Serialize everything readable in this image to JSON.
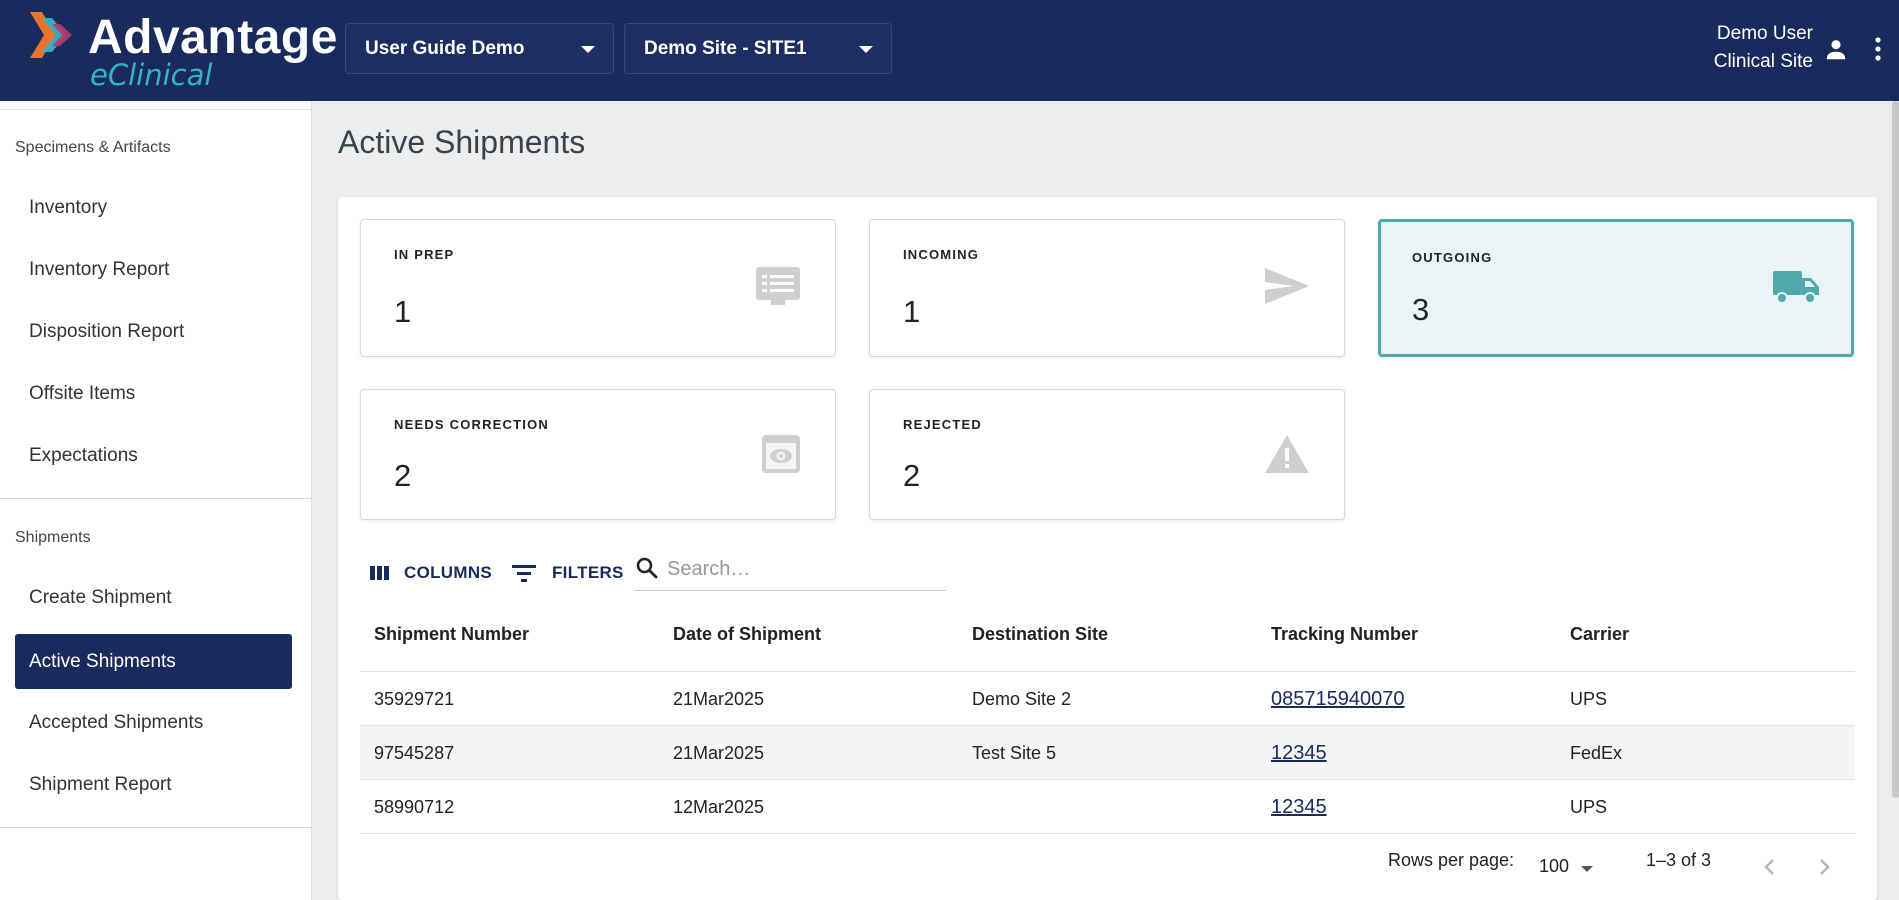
{
  "header": {
    "logo_title": "Advantage",
    "logo_subtitle": "eClinical",
    "study_select": "User Guide Demo",
    "site_select": "Demo Site - SITE1",
    "user_name": "Demo User",
    "user_role": "Clinical Site",
    "icons": [
      "person-icon",
      "more-vert-icon",
      "chevron-down-icon"
    ]
  },
  "sidebar": {
    "section1_title": "Specimens & Artifacts",
    "section1_items": [
      {
        "label": "Inventory"
      },
      {
        "label": "Inventory Report"
      },
      {
        "label": "Disposition Report"
      },
      {
        "label": "Offsite Items"
      },
      {
        "label": "Expectations"
      }
    ],
    "section2_title": "Shipments",
    "section2_items": [
      {
        "label": "Create Shipment"
      },
      {
        "label": "Active Shipments",
        "active": true
      },
      {
        "label": "Accepted Shipments"
      },
      {
        "label": "Shipment Report"
      }
    ]
  },
  "main": {
    "title": "Active Shipments",
    "cards": [
      {
        "label": "IN PREP",
        "value": "1",
        "icon": "list-icon"
      },
      {
        "label": "INCOMING",
        "value": "1",
        "icon": "send-icon"
      },
      {
        "label": "OUTGOING",
        "value": "3",
        "icon": "truck-icon",
        "selected": true
      },
      {
        "label": "NEEDS CORRECTION",
        "value": "2",
        "icon": "preview-eye-icon"
      },
      {
        "label": "REJECTED",
        "value": "2",
        "icon": "warning-icon"
      }
    ],
    "toolbar": {
      "columns_label": "COLUMNS",
      "filters_label": "FILTERS",
      "search_placeholder": "Search…"
    },
    "table": {
      "headers": [
        "Shipment Number",
        "Date of Shipment",
        "Destination Site",
        "Tracking Number",
        "Carrier"
      ],
      "rows": [
        [
          "35929721",
          "21Mar2025",
          "Demo Site 2",
          "085715940070",
          "UPS"
        ],
        [
          "97545287",
          "21Mar2025",
          "Test Site 5",
          "12345",
          "FedEx"
        ],
        [
          "58990712",
          "12Mar2025",
          "",
          "12345",
          "UPS"
        ]
      ]
    },
    "pagination": {
      "rows_per_page_label": "Rows per page:",
      "rows_per_page_value": "100",
      "range_text": "1–3 of 3"
    }
  },
  "colors": {
    "header_bg": "#192a5c",
    "accent_teal": "#4fa9ad",
    "logo_sub": "#33b3c6"
  }
}
